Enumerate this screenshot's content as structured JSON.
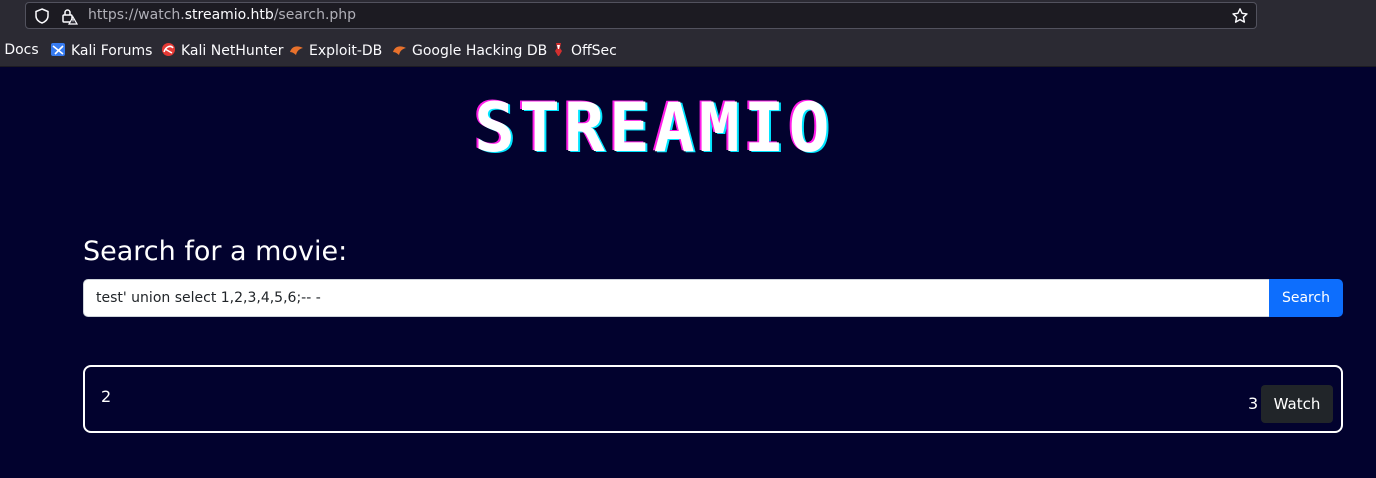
{
  "browser": {
    "url_scheme": "https://watch.",
    "url_host": "streamio.htb",
    "url_path": "/search.php",
    "bookmarks": [
      {
        "label": "i Docs",
        "icon": "kali-docs-icon"
      },
      {
        "label": "Kali Forums",
        "icon": "kali-forums-icon"
      },
      {
        "label": "Kali NetHunter",
        "icon": "kali-nethunter-icon"
      },
      {
        "label": "Exploit-DB",
        "icon": "exploit-db-icon"
      },
      {
        "label": "Google Hacking DB",
        "icon": "ghdb-icon"
      },
      {
        "label": "OffSec",
        "icon": "offsec-icon"
      }
    ]
  },
  "page": {
    "logo_text": "STREAMIO",
    "search_heading": "Search for a movie:",
    "search_value": "test' union select 1,2,3,4,5,6;-- -",
    "search_button": "Search",
    "result": {
      "title": "2",
      "meta": "3",
      "watch_button": "Watch"
    }
  },
  "colors": {
    "background": "#02022e",
    "search_button": "#0d6efd",
    "logo_cyan": "#00e5ff",
    "logo_magenta": "#ff1ee8"
  }
}
